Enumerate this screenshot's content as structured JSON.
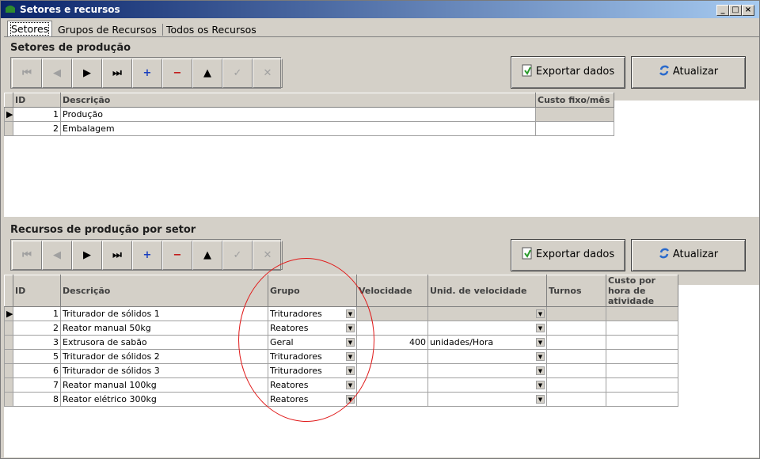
{
  "window": {
    "title": "Setores e recursos"
  },
  "tabs": [
    {
      "label": "Setores",
      "active": true
    },
    {
      "label": "Grupos de Recursos",
      "active": false
    },
    {
      "label": "Todos os Recursos",
      "active": false
    }
  ],
  "sectors": {
    "title": "Setores de produção",
    "export_label": "Exportar dados",
    "refresh_label": "Atualizar",
    "columns": [
      "ID",
      "Descrição",
      "Custo fixo/mês"
    ],
    "rows": [
      {
        "id": "1",
        "desc": "Produção",
        "cost": ""
      },
      {
        "id": "2",
        "desc": "Embalagem",
        "cost": ""
      }
    ]
  },
  "resources": {
    "title": "Recursos de produção por setor",
    "export_label": "Exportar dados",
    "refresh_label": "Atualizar",
    "columns": [
      "ID",
      "Descrição",
      "Grupo",
      "Velocidade",
      "Unid. de velocidade",
      "Turnos",
      "Custo por hora de atividade"
    ],
    "rows": [
      {
        "id": "1",
        "desc": "Triturador de sólidos 1",
        "group": "Trituradores",
        "speed": "",
        "unit": "",
        "shifts": "",
        "cost": ""
      },
      {
        "id": "2",
        "desc": "Reator manual 50kg",
        "group": "Reatores",
        "speed": "",
        "unit": "",
        "shifts": "",
        "cost": ""
      },
      {
        "id": "3",
        "desc": "Extrusora de sabão",
        "group": "Geral",
        "speed": "400",
        "unit": "unidades/Hora",
        "shifts": "",
        "cost": ""
      },
      {
        "id": "5",
        "desc": "Triturador de sólidos 2",
        "group": "Trituradores",
        "speed": "",
        "unit": "",
        "shifts": "",
        "cost": ""
      },
      {
        "id": "6",
        "desc": "Triturador de sólidos 3",
        "group": "Trituradores",
        "speed": "",
        "unit": "",
        "shifts": "",
        "cost": ""
      },
      {
        "id": "7",
        "desc": "Reator manual 100kg",
        "group": "Reatores",
        "speed": "",
        "unit": "",
        "shifts": "",
        "cost": ""
      },
      {
        "id": "8",
        "desc": "Reator elétrico 300kg",
        "group": "Reatores",
        "speed": "",
        "unit": "",
        "shifts": "",
        "cost": ""
      }
    ]
  },
  "navigator": {
    "buttons": [
      {
        "name": "first-record-button",
        "icon": "first-icon",
        "glyph": "⏮",
        "enabled": false
      },
      {
        "name": "prior-record-button",
        "icon": "prior-icon",
        "glyph": "◀",
        "enabled": false
      },
      {
        "name": "next-record-button",
        "icon": "next-icon",
        "glyph": "▶",
        "enabled": true
      },
      {
        "name": "last-record-button",
        "icon": "last-icon",
        "glyph": "⏭",
        "enabled": true
      },
      {
        "name": "insert-record-button",
        "icon": "plus-icon",
        "glyph": "+",
        "enabled": true
      },
      {
        "name": "delete-record-button",
        "icon": "minus-icon",
        "glyph": "−",
        "enabled": true
      },
      {
        "name": "edit-record-button",
        "icon": "up-triangle-icon",
        "glyph": "▲",
        "enabled": true
      },
      {
        "name": "post-record-button",
        "icon": "check-icon",
        "glyph": "✓",
        "enabled": false
      },
      {
        "name": "cancel-record-button",
        "icon": "cancel-icon",
        "glyph": "✕",
        "enabled": false
      }
    ]
  },
  "colors": {
    "title_bar": "#0a246a",
    "annotation": "#e01a1a",
    "face": "#d4d0c8"
  }
}
